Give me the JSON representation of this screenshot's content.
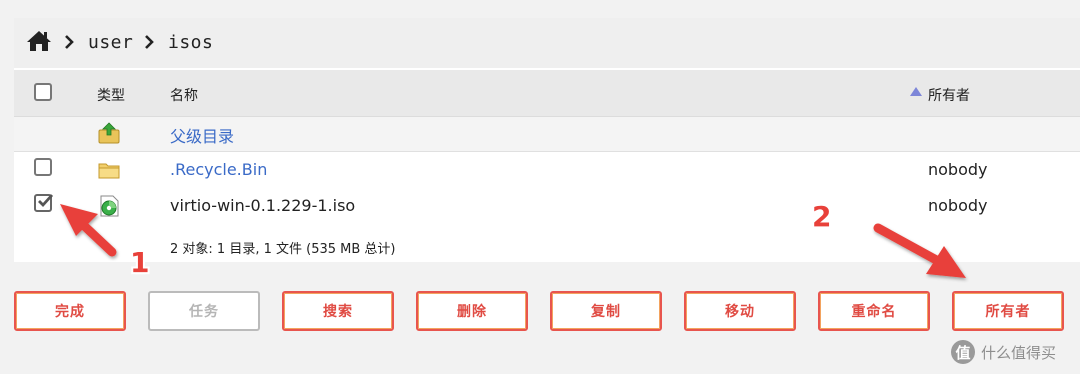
{
  "breadcrumb": {
    "home_icon": "home-icon",
    "items": [
      "user",
      "isos"
    ]
  },
  "table": {
    "headers": {
      "type": "类型",
      "name": "名称",
      "owner": "所有者"
    },
    "sort_indicator": "ascending",
    "parent_dir": {
      "label": "父级目录",
      "icon": "folder-up-icon"
    },
    "rows": [
      {
        "name": ".Recycle.Bin",
        "owner": "nobody",
        "icon": "folder-icon",
        "checked": false,
        "is_link": true
      },
      {
        "name": "virtio-win-0.1.229-1.iso",
        "owner": "nobody",
        "icon": "disc-file-icon",
        "checked": true,
        "is_link": false
      }
    ],
    "summary": "2 对象: 1 目录, 1 文件 (535 MB 总计)"
  },
  "buttons": [
    "完成",
    "任务",
    "搜索",
    "删除",
    "复制",
    "移动",
    "重命名",
    "所有者"
  ],
  "disabled_buttons": [
    "任务"
  ],
  "annotations": [
    "1",
    "2"
  ],
  "watermark": {
    "badge": "值",
    "text": "什么值得买"
  },
  "colors": {
    "accent": "#e8554e",
    "link": "#3a6ac7",
    "arrow": "#e8413a"
  }
}
